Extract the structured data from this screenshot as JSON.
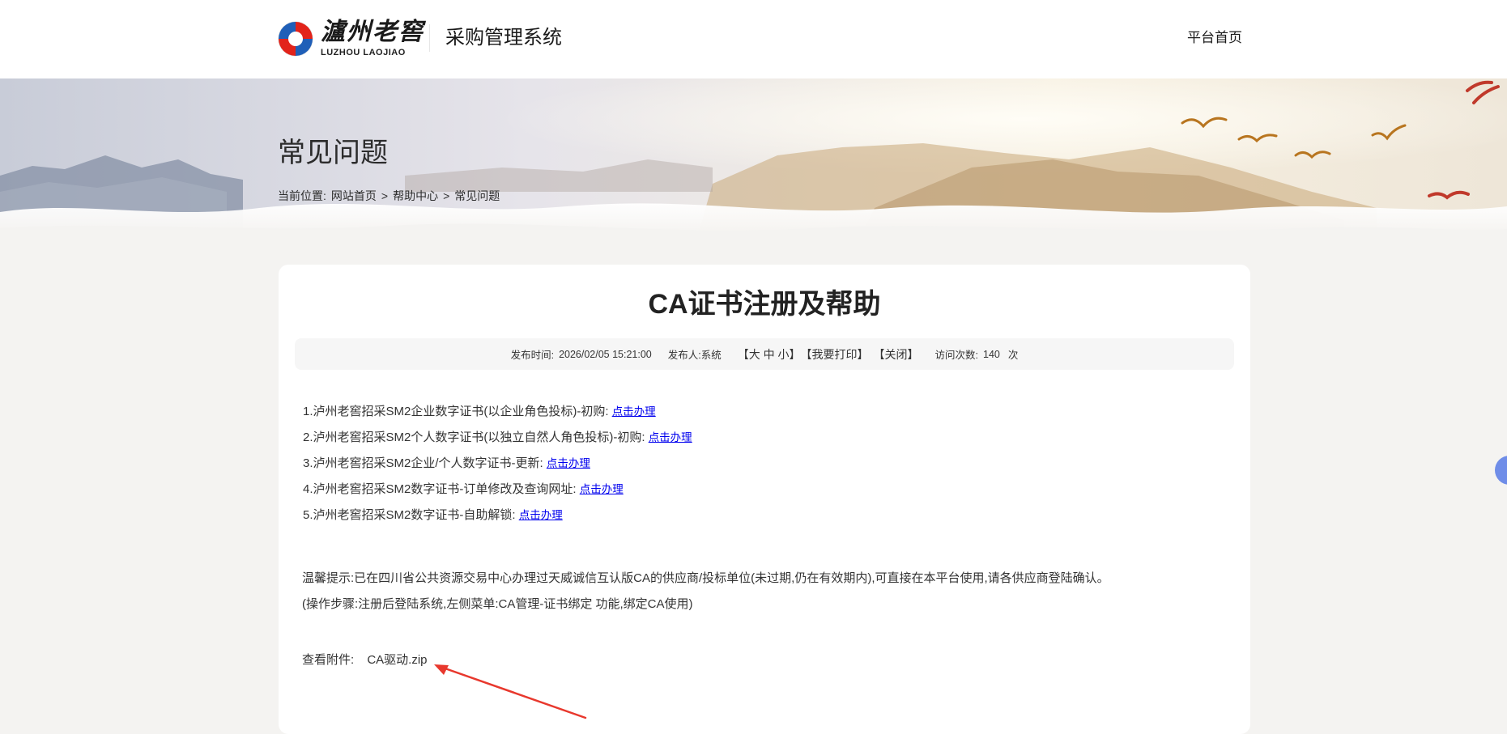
{
  "header": {
    "logo_cn": "瀘州老窖",
    "logo_en": "LUZHOU LAOJIAO",
    "system_name": "采购管理系统",
    "nav_home": "平台首页"
  },
  "banner": {
    "title": "常见问题",
    "breadcrumb_prefix": "当前位置:",
    "breadcrumb": [
      "网站首页",
      "帮助中心",
      "常见问题"
    ],
    "breadcrumb_sep": ">"
  },
  "article": {
    "title": "CA证书注册及帮助",
    "meta": {
      "publish_time_label": "发布时间:",
      "publish_time": "2026/02/05 15:21:00",
      "publisher_label": "发布人:",
      "publisher": "系统",
      "font_size_controls": "【大 中 小】",
      "print_label": "【我要打印】",
      "close_label": "【关闭】",
      "visits_label": "访问次数:",
      "visits": "140",
      "visits_unit": "次"
    },
    "items": [
      {
        "text": "1.泸州老窖招采SM2企业数字证书(以企业角色投标)-初购:",
        "link": "点击办理"
      },
      {
        "text": "2.泸州老窖招采SM2个人数字证书(以独立自然人角色投标)-初购:",
        "link": "点击办理"
      },
      {
        "text": "3.泸州老窖招采SM2企业/个人数字证书-更新:",
        "link": "点击办理"
      },
      {
        "text": "4.泸州老窖招采SM2数字证书-订单修改及查询网址:",
        "link": "点击办理"
      },
      {
        "text": "5.泸州老窖招采SM2数字证书-自助解锁:",
        "link": "点击办理"
      }
    ],
    "tip_line1": "温馨提示:已在四川省公共资源交易中心办理过天威诚信互认版CA的供应商/投标单位(未过期,仍在有效期内),可直接在本平台使用,请各供应商登陆确认。",
    "tip_line2": "(操作步骤:注册后登陆系统,左侧菜单:CA管理-证书绑定 功能,绑定CA使用)",
    "attachment_label": "查看附件:",
    "attachment_file": "CA驱动.zip"
  },
  "colors": {
    "link": "#0000ee",
    "annotation_arrow": "#e8382d",
    "side_tab": "#6f8de8"
  }
}
